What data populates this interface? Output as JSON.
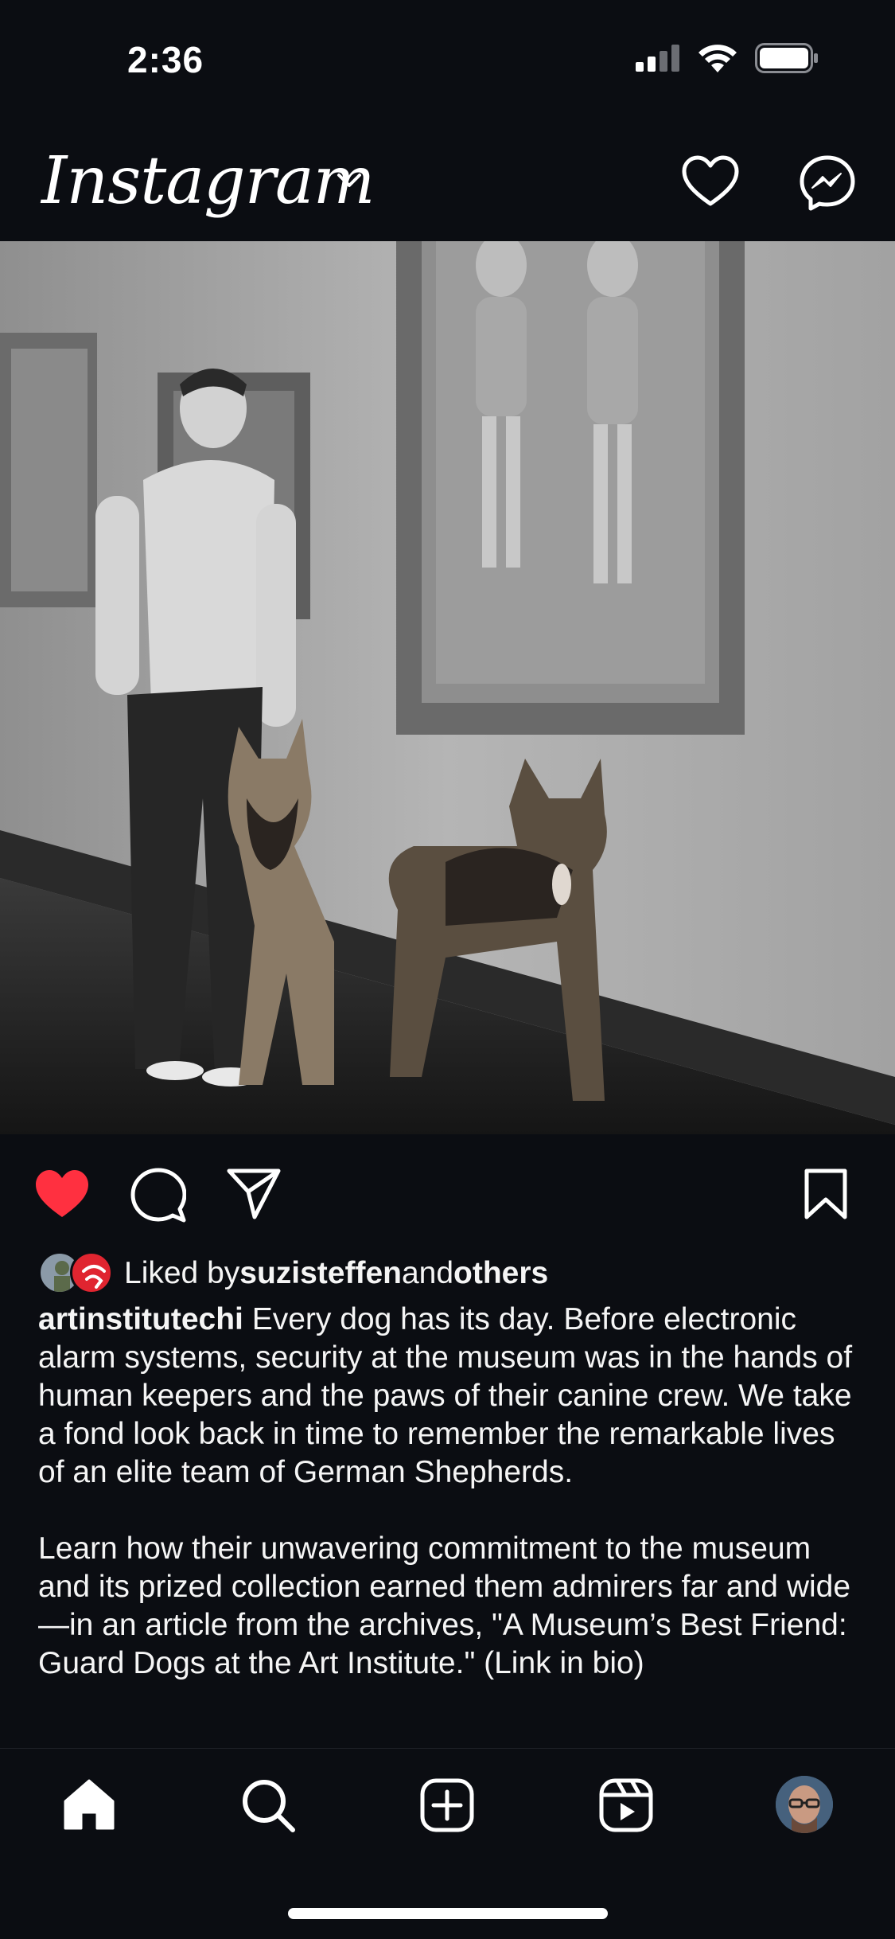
{
  "status_bar": {
    "time": "2:36",
    "icons": [
      "signal-icon",
      "wifi-icon",
      "battery-icon"
    ]
  },
  "header": {
    "logo": "Instagram",
    "icons": [
      "chevron-down-icon",
      "heart-icon",
      "messenger-icon"
    ]
  },
  "post": {
    "image_alt_icons": [
      "gallery-photo"
    ],
    "liked": true,
    "likes": {
      "prefix": "Liked by ",
      "user": "suzisteffen",
      "middle": " and ",
      "others": "others"
    },
    "caption": {
      "author": "artinstitutechi",
      "paragraph1": " Every dog has its day. Before electronic alarm systems, security at the museum was in the hands of human keepers and the paws of their canine crew. We take a fond look back in time to remember the remarkable lives of an elite team of German Shepherds.",
      "paragraph2": "Learn how their unwavering commitment to the museum and its prized collection earned them admirers far and wide—in an article from the archives, \"A Museum’s Best Friend: Guard Dogs at the Art Institute.\" (Link in bio)"
    }
  },
  "colors": {
    "background": "#0b0d12",
    "like_red": "#ff3040",
    "text": "#f5f5f5"
  },
  "tab_bar": {
    "items": [
      "home-icon",
      "search-icon",
      "create-icon",
      "reels-icon",
      "profile-avatar"
    ]
  }
}
